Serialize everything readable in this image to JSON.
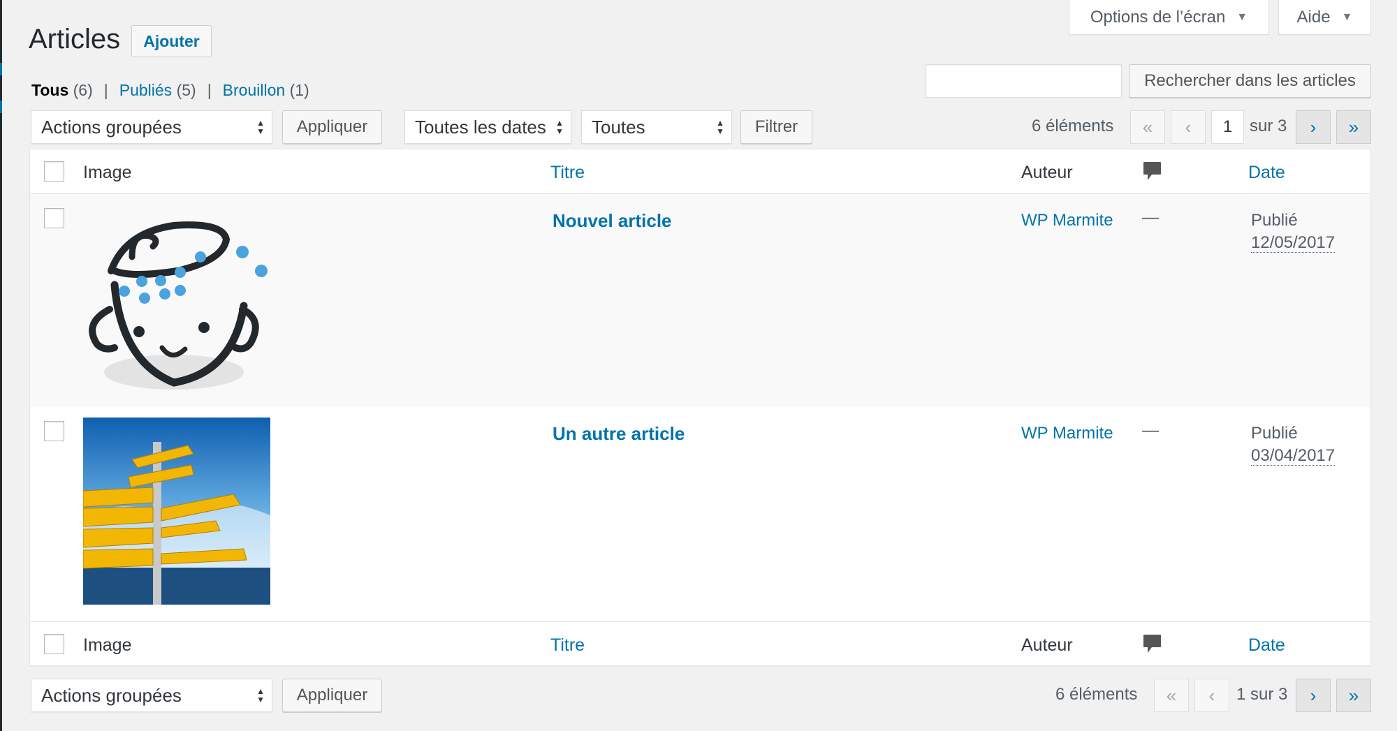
{
  "screen_meta": {
    "options_label": "Options de l’écran",
    "help_label": "Aide"
  },
  "header": {
    "title": "Articles",
    "add_label": "Ajouter"
  },
  "filters": {
    "all_label": "Tous",
    "all_count": "(6)",
    "published_label": "Publiés",
    "published_count": "(5)",
    "draft_label": "Brouillon",
    "draft_count": "(1)",
    "separator": "|"
  },
  "search": {
    "value": "",
    "button_label": "Rechercher dans les articles"
  },
  "tablenav_top": {
    "bulk_selected": "Actions groupées",
    "apply_label": "Appliquer",
    "dates_selected": "Toutes les dates",
    "category_selected": "Toutes",
    "filter_label": "Filtrer",
    "items_count": "6 éléments",
    "first": "«",
    "prev": "‹",
    "current_page": "1",
    "of_total": "sur 3",
    "next": "›",
    "last": "»"
  },
  "table": {
    "columns": {
      "image": "Image",
      "title": "Titre",
      "author": "Auteur",
      "date": "Date"
    },
    "rows": [
      {
        "title": "Nouvel article",
        "author": "WP Marmite",
        "comments": "—",
        "status": "Publié",
        "date": "12/05/2017",
        "thumb": "cooking-pot-mascot"
      },
      {
        "title": "Un autre article",
        "author": "WP Marmite",
        "comments": "—",
        "status": "Publié",
        "date": "03/04/2017",
        "thumb": "signpost-photo"
      }
    ]
  },
  "tablenav_bottom": {
    "bulk_selected": "Actions groupées",
    "apply_label": "Appliquer",
    "items_count": "6 éléments",
    "first": "«",
    "prev": "‹",
    "page_info": "1 sur 3",
    "next": "›",
    "last": "»"
  },
  "colors": {
    "link": "#0073aa",
    "background": "#f1f1f1",
    "text": "#23282d"
  }
}
